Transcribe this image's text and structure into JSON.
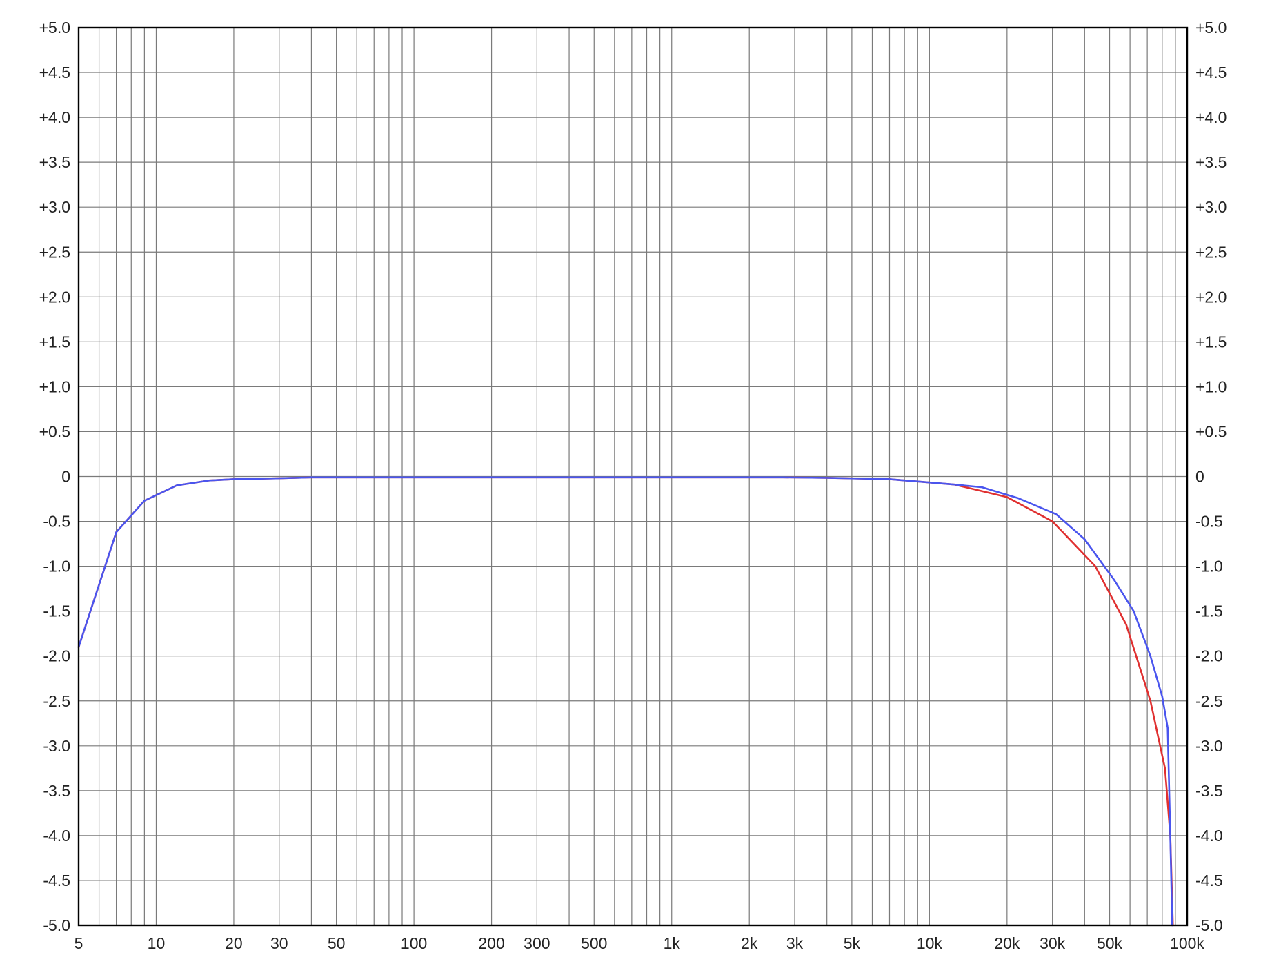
{
  "chart_data": {
    "type": "line",
    "title": "",
    "xlabel": "",
    "ylabel": "",
    "x_scale": "log",
    "xlim": [
      5,
      100000
    ],
    "ylim": [
      -5.0,
      5.0
    ],
    "grid": true,
    "legend": "none",
    "x_ticks": [
      {
        "value": 5,
        "label": "5"
      },
      {
        "value": 10,
        "label": "10"
      },
      {
        "value": 20,
        "label": "20"
      },
      {
        "value": 30,
        "label": "30"
      },
      {
        "value": 50,
        "label": "50"
      },
      {
        "value": 100,
        "label": "100"
      },
      {
        "value": 200,
        "label": "200"
      },
      {
        "value": 300,
        "label": "300"
      },
      {
        "value": 500,
        "label": "500"
      },
      {
        "value": 1000,
        "label": "1k"
      },
      {
        "value": 2000,
        "label": "2k"
      },
      {
        "value": 3000,
        "label": "3k"
      },
      {
        "value": 5000,
        "label": "5k"
      },
      {
        "value": 10000,
        "label": "10k"
      },
      {
        "value": 20000,
        "label": "20k"
      },
      {
        "value": 30000,
        "label": "30k"
      },
      {
        "value": 50000,
        "label": "50k"
      },
      {
        "value": 100000,
        "label": "100k"
      }
    ],
    "x_minor_gridlines": [
      6,
      7,
      8,
      9,
      40,
      60,
      70,
      80,
      90,
      400,
      600,
      700,
      800,
      900,
      4000,
      6000,
      7000,
      8000,
      9000,
      40000,
      60000,
      70000,
      80000,
      90000
    ],
    "y_ticks": [
      {
        "value": 5.0,
        "label": "+5.0"
      },
      {
        "value": 4.5,
        "label": "+4.5"
      },
      {
        "value": 4.0,
        "label": "+4.0"
      },
      {
        "value": 3.5,
        "label": "+3.5"
      },
      {
        "value": 3.0,
        "label": "+3.0"
      },
      {
        "value": 2.5,
        "label": "+2.5"
      },
      {
        "value": 2.0,
        "label": "+2.0"
      },
      {
        "value": 1.5,
        "label": "+1.5"
      },
      {
        "value": 1.0,
        "label": "+1.0"
      },
      {
        "value": 0.5,
        "label": "+0.5"
      },
      {
        "value": 0.0,
        "label": "0"
      },
      {
        "value": -0.5,
        "label": "-0.5"
      },
      {
        "value": -1.0,
        "label": "-1.0"
      },
      {
        "value": -1.5,
        "label": "-1.5"
      },
      {
        "value": -2.0,
        "label": "-2.0"
      },
      {
        "value": -2.5,
        "label": "-2.5"
      },
      {
        "value": -3.0,
        "label": "-3.0"
      },
      {
        "value": -3.5,
        "label": "-3.5"
      },
      {
        "value": -4.0,
        "label": "-4.0"
      },
      {
        "value": -4.5,
        "label": "-4.5"
      },
      {
        "value": -5.0,
        "label": "-5.0"
      }
    ],
    "series": [
      {
        "color": "#e03030",
        "points": [
          [
            5,
            -1.9
          ],
          [
            7,
            -0.62
          ],
          [
            9,
            -0.27
          ],
          [
            12,
            -0.1
          ],
          [
            16,
            -0.045
          ],
          [
            20,
            -0.03
          ],
          [
            30,
            -0.02
          ],
          [
            40,
            -0.01
          ],
          [
            100,
            -0.01
          ],
          [
            1000,
            -0.01
          ],
          [
            2700,
            -0.01
          ],
          [
            4000,
            -0.015
          ],
          [
            7000,
            -0.03
          ],
          [
            12500,
            -0.09
          ],
          [
            20000,
            -0.23
          ],
          [
            30000,
            -0.5
          ],
          [
            44000,
            -1.0
          ],
          [
            58000,
            -1.65
          ],
          [
            72000,
            -2.5
          ],
          [
            82000,
            -3.25
          ],
          [
            86000,
            -4.0
          ],
          [
            88000,
            -5.0
          ]
        ]
      },
      {
        "color": "#4a55ee",
        "points": [
          [
            5,
            -1.9
          ],
          [
            7,
            -0.62
          ],
          [
            9,
            -0.27
          ],
          [
            12,
            -0.1
          ],
          [
            16,
            -0.045
          ],
          [
            20,
            -0.03
          ],
          [
            30,
            -0.02
          ],
          [
            40,
            -0.01
          ],
          [
            100,
            -0.01
          ],
          [
            1000,
            -0.01
          ],
          [
            2700,
            -0.01
          ],
          [
            4000,
            -0.015
          ],
          [
            7000,
            -0.03
          ],
          [
            12500,
            -0.09
          ],
          [
            16000,
            -0.12
          ],
          [
            22000,
            -0.24
          ],
          [
            31000,
            -0.42
          ],
          [
            40000,
            -0.7
          ],
          [
            52000,
            -1.15
          ],
          [
            62000,
            -1.5
          ],
          [
            72000,
            -2.0
          ],
          [
            80000,
            -2.45
          ],
          [
            84000,
            -2.8
          ],
          [
            86000,
            -4.0
          ],
          [
            87500,
            -5.0
          ]
        ]
      }
    ]
  }
}
